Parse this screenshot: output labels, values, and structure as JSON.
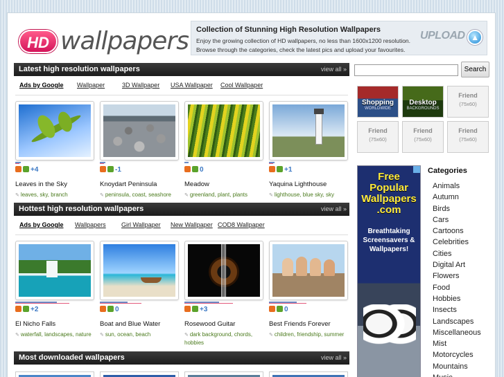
{
  "logo": {
    "hd": "HD",
    "word": "wallpapers"
  },
  "intro": {
    "title": "Collection of Stunning High Resolution Wallpapers",
    "text": "Enjoy the growing collection of HD wallpapers, no less than 1600x1200 resolution. Browse through the categories, check the latest pics and upload your favourites.",
    "upload_label": "UPLOAD"
  },
  "search": {
    "button": "Search",
    "placeholder": ""
  },
  "sections": [
    {
      "title": "Latest high resolution wallpapers",
      "view_all": "view all »",
      "ads": [
        "Ads by Google",
        "Wallpaper",
        "3D Wallpaper",
        "USA Wallpaper",
        "Cool Wallpaper"
      ],
      "items": [
        {
          "title": "Leaves in the Sky",
          "votes": "+4",
          "tags": [
            "leaves",
            "sky",
            "branch"
          ]
        },
        {
          "title": "Knoydart Peninsula",
          "votes": "-1",
          "tags": [
            "peninsula",
            "coast",
            "seashore"
          ]
        },
        {
          "title": "Meadow",
          "votes": "0",
          "tags": [
            "greenland",
            "plant",
            "plants"
          ]
        },
        {
          "title": "Yaquina Lighthouse",
          "votes": "+1",
          "tags": [
            "lighthouse",
            "blue sky",
            "sky"
          ]
        }
      ]
    },
    {
      "title": "Hottest high resolution wallpapers",
      "view_all": "view all »",
      "ads": [
        "Ads by Google",
        "Wallpapers",
        "Girl Wallpaper",
        "New Wallpaper",
        "COD8 Wallpaper"
      ],
      "items": [
        {
          "title": "El Nicho Falls",
          "votes": "+2",
          "tags": [
            "waterfall",
            "landscapes",
            "nature"
          ]
        },
        {
          "title": "Boat and Blue Water",
          "votes": "0",
          "tags": [
            "sun",
            "ocean",
            "beach"
          ]
        },
        {
          "title": "Rosewood Guitar",
          "votes": "+3",
          "tags": [
            "dark background",
            "chords",
            "hobbies"
          ]
        },
        {
          "title": "Best Friends Forever",
          "votes": "0",
          "tags": [
            "children",
            "friendship",
            "summer"
          ]
        }
      ]
    },
    {
      "title": "Most downloaded wallpapers",
      "view_all": "view all »"
    }
  ],
  "promos": [
    {
      "l1": "Shopping",
      "l2": "WORLDWIDE"
    },
    {
      "l1": "Desktop",
      "l2": "BACKGROUNDS"
    },
    {
      "l1": "Friend",
      "l2": "(75x60)"
    },
    {
      "l1": "Friend",
      "l2": "(75x60)"
    },
    {
      "l1": "Friend",
      "l2": "(75x60)"
    },
    {
      "l1": "Friend",
      "l2": "(75x60)"
    }
  ],
  "ad_banner": {
    "big": "Free Popular Wallpapers .com",
    "small": "Breathtaking Screensavers & Wallpapers!"
  },
  "categories": {
    "title": "Categories",
    "items": [
      "Animals",
      "Autumn",
      "Birds",
      "Cars",
      "Cartoons",
      "Celebrities",
      "Cities",
      "Digital Art",
      "Flowers",
      "Food",
      "Hobbies",
      "Insects",
      "Landscapes",
      "Miscellaneous",
      "Mist",
      "Motorcycles",
      "Mountains",
      "Music"
    ]
  }
}
